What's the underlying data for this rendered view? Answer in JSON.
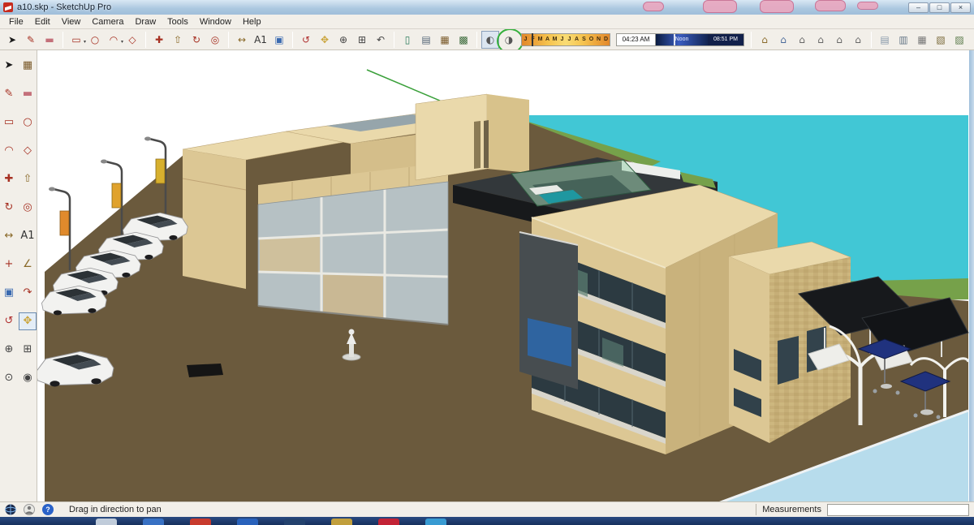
{
  "window": {
    "title": "a10.skp - SketchUp Pro",
    "controls": {
      "minimize": "–",
      "restore": "□",
      "close": "×"
    }
  },
  "menu": {
    "items": [
      "File",
      "Edit",
      "View",
      "Camera",
      "Draw",
      "Tools",
      "Window",
      "Help"
    ]
  },
  "toolbar": {
    "groups": [
      {
        "name": "principal",
        "items": [
          {
            "name": "select-tool",
            "glyph": "➤",
            "color": "#1a1a1a"
          },
          {
            "name": "line-tool",
            "glyph": "✎",
            "color": "#a63022"
          },
          {
            "name": "eraser-tool",
            "glyph": "▬",
            "color": "#c4707a"
          }
        ]
      },
      {
        "name": "shapes",
        "items": [
          {
            "name": "rectangle-tool",
            "glyph": "▭",
            "color": "#a63022",
            "dropdown": true
          },
          {
            "name": "circle-tool",
            "glyph": "○",
            "color": "#a63022"
          },
          {
            "name": "arc-tool",
            "glyph": "◠",
            "color": "#a63022",
            "dropdown": true
          },
          {
            "name": "polygon-tool",
            "glyph": "◇",
            "color": "#a63022"
          }
        ]
      },
      {
        "name": "modify",
        "items": [
          {
            "name": "move-tool",
            "glyph": "✚",
            "color": "#a63022"
          },
          {
            "name": "push-pull-tool",
            "glyph": "⇧",
            "color": "#8a6a2a"
          },
          {
            "name": "rotate-tool",
            "glyph": "↻",
            "color": "#a63022"
          },
          {
            "name": "offset-tool",
            "glyph": "◎",
            "color": "#a63022"
          }
        ]
      },
      {
        "name": "construction",
        "items": [
          {
            "name": "tape-measure-tool",
            "glyph": "↔",
            "color": "#8a6a2a"
          },
          {
            "name": "text-tool",
            "glyph": "A1",
            "color": "#333333"
          },
          {
            "name": "paint-bucket-tool",
            "glyph": "▣",
            "color": "#3a6ab0"
          }
        ]
      },
      {
        "name": "camera",
        "items": [
          {
            "name": "orbit-tool",
            "glyph": "↺",
            "color": "#b03030"
          },
          {
            "name": "pan-tool",
            "glyph": "✥",
            "color": "#caa43a"
          },
          {
            "name": "zoom-tool",
            "glyph": "⊕",
            "color": "#444444"
          },
          {
            "name": "zoom-extents-tool",
            "glyph": "⊞",
            "color": "#444444"
          },
          {
            "name": "previous-view-tool",
            "glyph": "↶",
            "color": "#444444"
          }
        ]
      },
      {
        "name": "section-styles",
        "items": [
          {
            "name": "section-plane-tool",
            "glyph": "▯",
            "color": "#2a7a5a"
          },
          {
            "name": "style-wireframe",
            "glyph": "▤",
            "color": "#556677"
          },
          {
            "name": "style-shaded",
            "glyph": "▦",
            "color": "#7a5a2a"
          },
          {
            "name": "style-textured",
            "glyph": "▩",
            "color": "#3a6a3a"
          }
        ]
      },
      {
        "name": "shadow",
        "append_sliders": true,
        "items": [
          {
            "name": "shadow-settings-button",
            "glyph": "◐",
            "color": "#555555",
            "pressed": true
          },
          {
            "name": "shadow-toggle-button",
            "glyph": "◑",
            "color": "#555555",
            "annotated": true
          }
        ]
      },
      {
        "name": "views",
        "items": [
          {
            "name": "view-iso",
            "glyph": "⌂",
            "color": "#8a6a2a"
          },
          {
            "name": "view-top",
            "glyph": "⌂",
            "color": "#4a6a9a"
          },
          {
            "name": "view-front",
            "glyph": "⌂",
            "color": "#666666"
          },
          {
            "name": "view-right",
            "glyph": "⌂",
            "color": "#666666"
          },
          {
            "name": "view-back",
            "glyph": "⌂",
            "color": "#666666"
          },
          {
            "name": "view-left",
            "glyph": "⌂",
            "color": "#666666"
          }
        ]
      },
      {
        "name": "face-style",
        "items": [
          {
            "name": "face-style-xray",
            "glyph": "▤",
            "color": "#8899aa"
          },
          {
            "name": "face-style-wireframe",
            "glyph": "▥",
            "color": "#667788"
          },
          {
            "name": "face-style-hidden-line",
            "glyph": "▦",
            "color": "#777777"
          },
          {
            "name": "face-style-shaded",
            "glyph": "▧",
            "color": "#7a6a3a"
          },
          {
            "name": "face-style-textured",
            "glyph": "▨",
            "color": "#5a7a4a"
          },
          {
            "name": "face-style-monochrome",
            "glyph": "▩",
            "color": "#888888"
          }
        ]
      }
    ]
  },
  "shadows": {
    "months": [
      "J",
      "F",
      "M",
      "A",
      "M",
      "J",
      "J",
      "A",
      "S",
      "O",
      "N",
      "D"
    ],
    "time_start": "04:23 AM",
    "time_noon": "Noon",
    "time_end": "08:51 PM"
  },
  "left_toolbar": {
    "items": [
      {
        "name": "select-tool",
        "glyph": "➤",
        "color": "#1a1a1a"
      },
      {
        "name": "make-component-tool",
        "glyph": "▦",
        "color": "#7a5a2a"
      },
      {
        "name": "line-tool",
        "glyph": "✎",
        "color": "#a63022"
      },
      {
        "name": "eraser-tool",
        "glyph": "▬",
        "color": "#c4707a"
      },
      {
        "name": "rectangle-tool",
        "glyph": "▭",
        "color": "#a63022"
      },
      {
        "name": "circle-tool",
        "glyph": "○",
        "color": "#a63022"
      },
      {
        "name": "arc-tool",
        "glyph": "◠",
        "color": "#a63022"
      },
      {
        "name": "polygon-tool",
        "glyph": "◇",
        "color": "#a63022"
      },
      {
        "name": "move-tool",
        "glyph": "✚",
        "color": "#a63022"
      },
      {
        "name": "push-pull-tool",
        "glyph": "⇧",
        "color": "#8a6a2a"
      },
      {
        "name": "rotate-tool",
        "glyph": "↻",
        "color": "#a63022"
      },
      {
        "name": "offset-tool",
        "glyph": "◎",
        "color": "#a63022"
      },
      {
        "name": "tape-measure-tool",
        "glyph": "↔",
        "color": "#8a6a2a"
      },
      {
        "name": "text-tool",
        "glyph": "A1",
        "color": "#333333"
      },
      {
        "name": "axes-tool",
        "glyph": "+",
        "color": "#a63022"
      },
      {
        "name": "dimension-tool",
        "glyph": "∠",
        "color": "#8a6a2a"
      },
      {
        "name": "paint-bucket-tool",
        "glyph": "▣",
        "color": "#3a6ab0"
      },
      {
        "name": "follow-me-tool",
        "glyph": "↷",
        "color": "#a63022"
      },
      {
        "name": "orbit-tool",
        "glyph": "↺",
        "color": "#b03030"
      },
      {
        "name": "pan-tool",
        "glyph": "✥",
        "color": "#caa43a",
        "active": true
      },
      {
        "name": "zoom-tool",
        "glyph": "⊕",
        "color": "#444444"
      },
      {
        "name": "zoom-extents-tool",
        "glyph": "⊞",
        "color": "#444444"
      },
      {
        "name": "position-camera-tool",
        "glyph": "⊙",
        "color": "#444444"
      },
      {
        "name": "look-around-tool",
        "glyph": "◉",
        "color": "#444444"
      }
    ]
  },
  "statusbar": {
    "hint": "Drag in direction to pan",
    "measurements_label": "Measurements",
    "measurements_value": ""
  },
  "scene": {
    "colors": {
      "water": "#41c7d5",
      "shore-water": "#b7dcec",
      "ground": "#6b5a3d",
      "grass": "#76a14a",
      "tan-light": "#ead9ab",
      "tan": "#dcc794",
      "tan-dark": "#c9b27c",
      "glass": "#b6c1c4",
      "dark-roof": "#33383b",
      "pool-teal": "#1f97a0",
      "umbrella": "#20327e",
      "car": "#f2f2f0",
      "axis-green": "#3aa03a"
    }
  },
  "taskbar": {
    "icons": [
      {
        "name": "taskbar-app-1",
        "color": "#c9d4e0"
      },
      {
        "name": "taskbar-app-2",
        "color": "#3a74c8"
      },
      {
        "name": "taskbar-app-3",
        "color": "#d23b2a"
      },
      {
        "name": "taskbar-app-4",
        "color": "#2a64c0"
      },
      {
        "name": "taskbar-app-5",
        "color": "#24426e"
      },
      {
        "name": "taskbar-app-6",
        "color": "#caa43a"
      },
      {
        "name": "taskbar-app-7",
        "color": "#cc2233"
      },
      {
        "name": "taskbar-app-8",
        "color": "#3aa0d8"
      }
    ]
  }
}
